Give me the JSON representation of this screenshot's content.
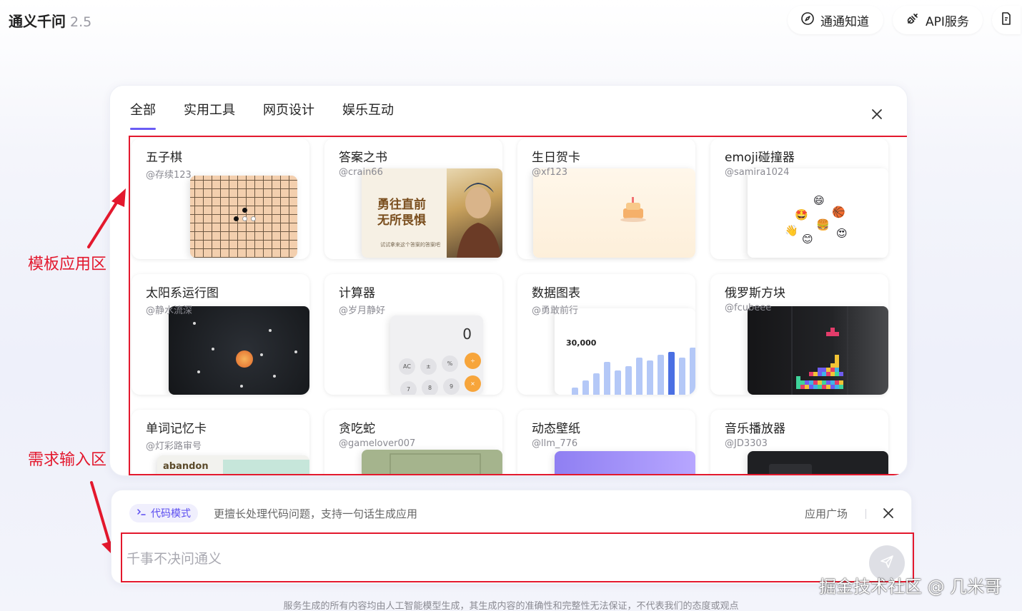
{
  "brand": {
    "name": "通义千问",
    "version": "2.5"
  },
  "header": {
    "tongtong_label": "通通知道",
    "api_label": "API服务"
  },
  "panel": {
    "tabs": [
      {
        "label": "全部",
        "active": true
      },
      {
        "label": "实用工具",
        "active": false
      },
      {
        "label": "网页设计",
        "active": false
      },
      {
        "label": "娱乐互动",
        "active": false
      }
    ],
    "cards": [
      {
        "title": "五子棋",
        "author": "@存续123",
        "thumb": "gobang-board"
      },
      {
        "title": "答案之书",
        "author": "@crain66",
        "thumb": "answer-book",
        "thumb_text": [
          "勇往直前",
          "无所畏惧"
        ],
        "thumb_small": "试试拿来这个答案的答案吧"
      },
      {
        "title": "生日贺卡",
        "author": "@xf123",
        "thumb": "birthday-cake"
      },
      {
        "title": "emoji碰撞器",
        "author": "@samira1024",
        "thumb": "emoji-cluster"
      },
      {
        "title": "太阳系运行图",
        "author": "@静水流深",
        "thumb": "solar-system"
      },
      {
        "title": "计算器",
        "author": "@岁月静好",
        "thumb": "calculator",
        "display": "0",
        "keys": [
          "AC",
          "±",
          "%",
          "÷",
          "7",
          "8",
          "9",
          "×"
        ]
      },
      {
        "title": "数据图表",
        "author": "@勇敢前行",
        "thumb": "bar-chart",
        "value": "30,000"
      },
      {
        "title": "俄罗斯方块",
        "author": "@fcubeee",
        "thumb": "tetris"
      },
      {
        "title": "单词记忆卡",
        "author": "@灯彩路审号",
        "thumb": "word-card",
        "word": "abandon"
      },
      {
        "title": "贪吃蛇",
        "author": "@gamelover007",
        "thumb": "snake-game"
      },
      {
        "title": "动态壁纸",
        "author": "@llm_776",
        "thumb": "wallpaper"
      },
      {
        "title": "音乐播放器",
        "author": "@JD3303",
        "thumb": "music-player"
      }
    ]
  },
  "annotations": {
    "template_area": "模板应用区",
    "input_area": "需求输入区"
  },
  "input": {
    "mode_label": "代码模式",
    "mode_desc": "更擅长处理代码问题，支持一句话生成应用",
    "app_square": "应用广场",
    "placeholder": "千事不决问通义"
  },
  "watermark": "掘金技术社区 @ 几米哥",
  "disclaimer": "服务生成的所有内容均由人工智能模型生成，其生成内容的准确性和完整性无法保证，不代表我们的态度或观点",
  "colors": {
    "accent": "#6a5cf5",
    "annotation_red": "#e3182d",
    "chip_bg": "#f0effd"
  }
}
